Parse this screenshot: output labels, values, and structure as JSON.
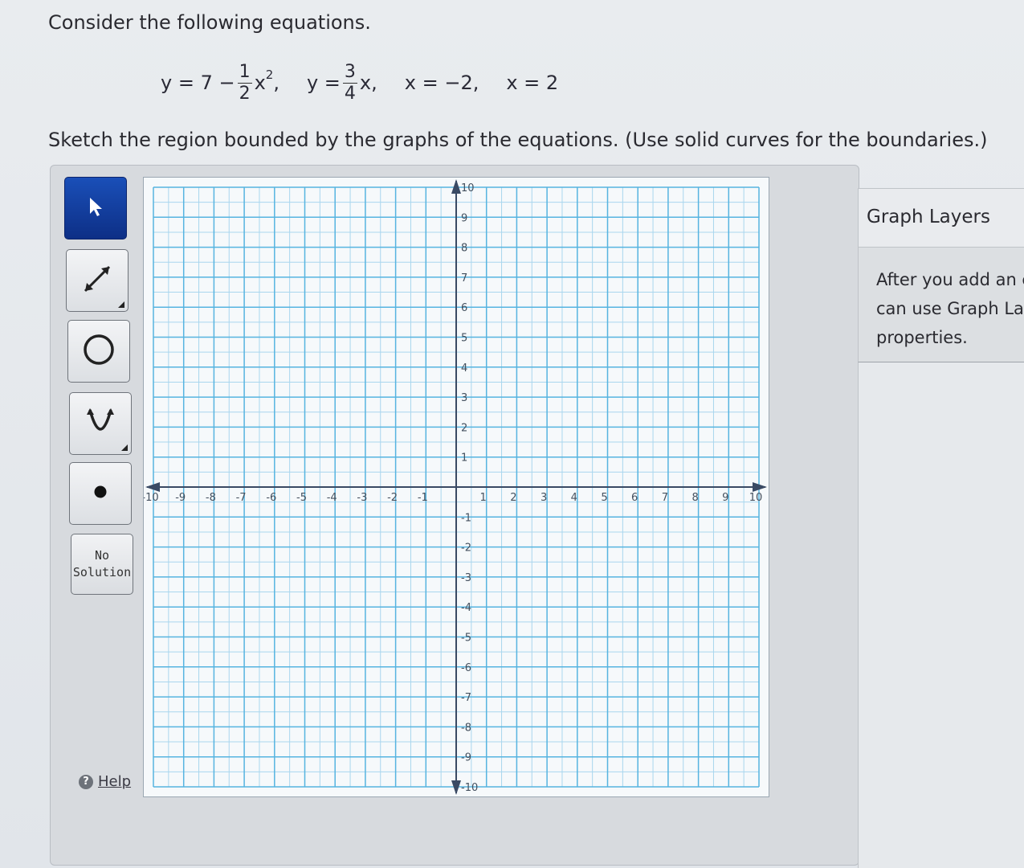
{
  "problem": {
    "prompt": "Consider the following equations.",
    "equations": [
      {
        "lhs": "y = 7 −",
        "num": "1",
        "den": "2",
        "var": "x",
        "sup": "2",
        "trail": ","
      },
      {
        "lhs": "y =",
        "num": "3",
        "den": "4",
        "var": "x",
        "trail": ","
      },
      {
        "text": "x = −2,"
      },
      {
        "text": "x = 2"
      }
    ],
    "instructions": "Sketch the region bounded by the graphs of the equations. (Use solid curves for the boundaries.)"
  },
  "toolbar": {
    "tools": [
      {
        "icon": "pointer-arrow-icon",
        "active": true
      },
      {
        "icon": "line-tool-icon",
        "has_submenu": true
      },
      {
        "icon": "circle-tool-icon"
      },
      {
        "icon": "parabola-tool-icon",
        "has_submenu": true
      },
      {
        "icon": "point-tool-icon"
      }
    ],
    "no_solution": {
      "line1": "No",
      "line2": "Solution"
    },
    "help_label": "Help"
  },
  "graph": {
    "x_range": [
      -10,
      10
    ],
    "y_range": [
      -10,
      10
    ],
    "x_tick_labels": [
      "-10",
      "-9",
      "-8",
      "-7",
      "-6",
      "-5",
      "-4",
      "-3",
      "-2",
      "-1",
      "1",
      "2",
      "3",
      "4",
      "5",
      "6",
      "7",
      "8",
      "9",
      "10"
    ],
    "y_tick_labels": [
      "10",
      "9",
      "8",
      "7",
      "6",
      "5",
      "4",
      "3",
      "2",
      "1",
      "-1",
      "-2",
      "-3",
      "-4",
      "-5",
      "-6",
      "-7",
      "-8",
      "-9",
      "-10"
    ],
    "grid_color": "#56b4e0",
    "minor_grid_color": "#a9d6ee",
    "axis_color": "#3a4a64"
  },
  "graph_layers": {
    "title": "Graph Layers",
    "message_lines": [
      "After you add an c",
      "can use Graph La",
      "properties."
    ]
  }
}
